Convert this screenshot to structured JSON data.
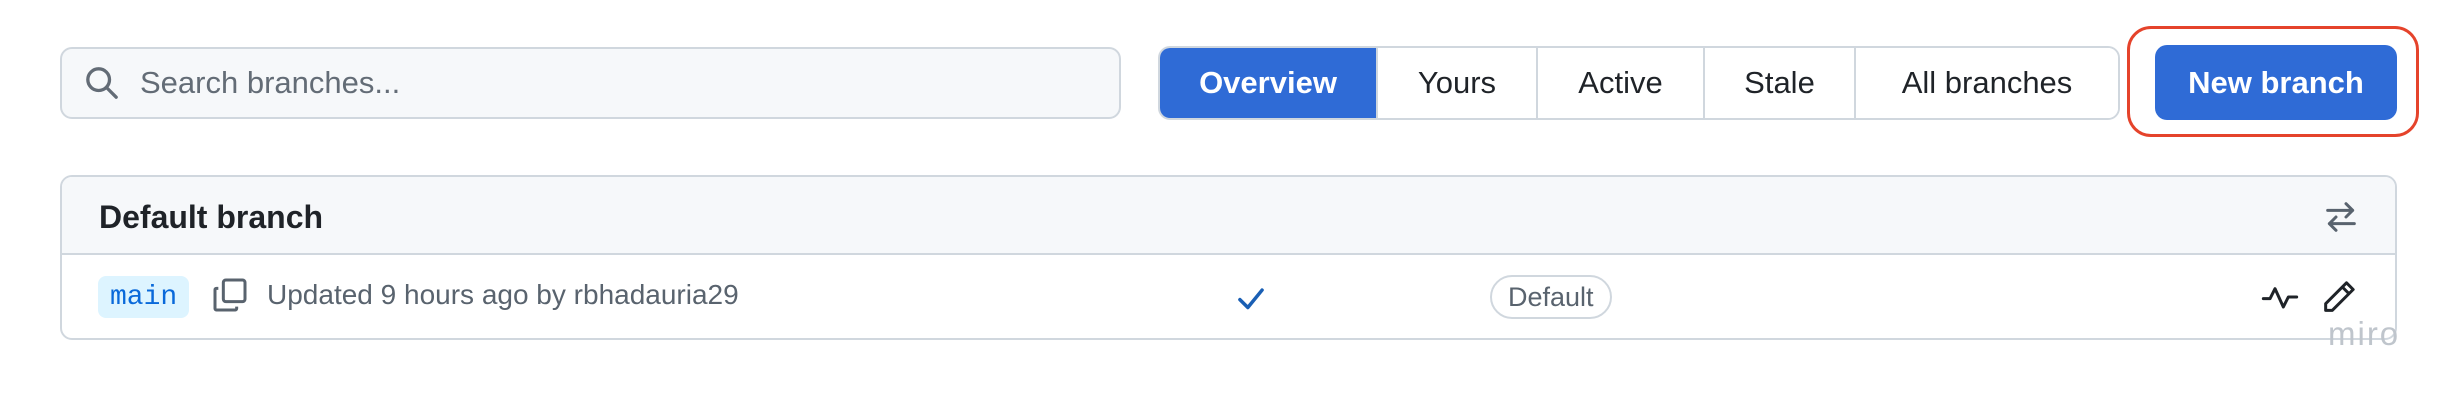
{
  "search": {
    "placeholder": "Search branches..."
  },
  "tabs": [
    {
      "label": "Overview",
      "active": true
    },
    {
      "label": "Yours",
      "active": false
    },
    {
      "label": "Active",
      "active": false
    },
    {
      "label": "Stale",
      "active": false
    },
    {
      "label": "All branches",
      "active": false
    }
  ],
  "new_branch_label": "New branch",
  "default_section": {
    "title": "Default branch",
    "branch": {
      "name": "main",
      "updated_prefix": "Updated 9 hours ago by",
      "user": "rbhadauria29",
      "badge": "Default"
    }
  },
  "watermark": "miro",
  "colors": {
    "accent": "#2f6bd6",
    "highlight": "#e5432b",
    "border": "#d0d7de",
    "check": "#1a5fb4"
  },
  "icons": [
    "search-icon",
    "swap-icon",
    "copy-icon",
    "check-icon",
    "activity-icon",
    "pencil-icon"
  ]
}
